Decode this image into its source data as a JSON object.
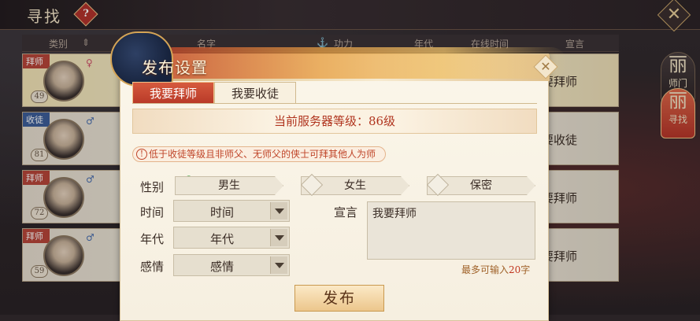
{
  "topbar": {
    "title": "寻找",
    "help": "?"
  },
  "list_header": {
    "category": "类别",
    "name": "名字",
    "power": "功力",
    "era": "年代",
    "online_time": "在线时间",
    "declaration": "宣言"
  },
  "rows": [
    {
      "tag": "拜师",
      "level": "49",
      "gender": "♀",
      "declaration": "我要拜师"
    },
    {
      "tag": "收徒",
      "level": "81",
      "gender": "♂",
      "declaration": "我要收徒"
    },
    {
      "tag": "拜师",
      "level": "72",
      "gender": "♂",
      "declaration": "我要拜师"
    },
    {
      "tag": "拜师",
      "level": "59",
      "gender": "♂",
      "declaration": "我要拜师"
    }
  ],
  "side_tabs": [
    {
      "label": "师门",
      "glyph": "丽",
      "active": false
    },
    {
      "label": "寻找",
      "glyph": "丽",
      "active": true
    }
  ],
  "dialog": {
    "title": "发布设置",
    "close": "✕",
    "tabs": [
      "我要拜师",
      "我要收徒"
    ],
    "server_level": "当前服务器等级：86级",
    "notice_icon": "!",
    "notice": "低于收徒等级且非师父、无师父的侠士可拜其他人为师",
    "labels": {
      "gender": "性别",
      "time": "时间",
      "era": "年代",
      "emotion": "感情",
      "declare": "宣言"
    },
    "gender_options": [
      "男生",
      "女生",
      "保密"
    ],
    "selects": {
      "time": "时间",
      "era": "年代",
      "emotion": "感情"
    },
    "declare_text": "我要拜师",
    "char_limit_prefix": "最多可输入",
    "char_limit_num": "20",
    "char_limit_suffix": "字",
    "publish": "发布"
  },
  "colors": {
    "accent": "#b93a28",
    "check": "#37a03a"
  }
}
